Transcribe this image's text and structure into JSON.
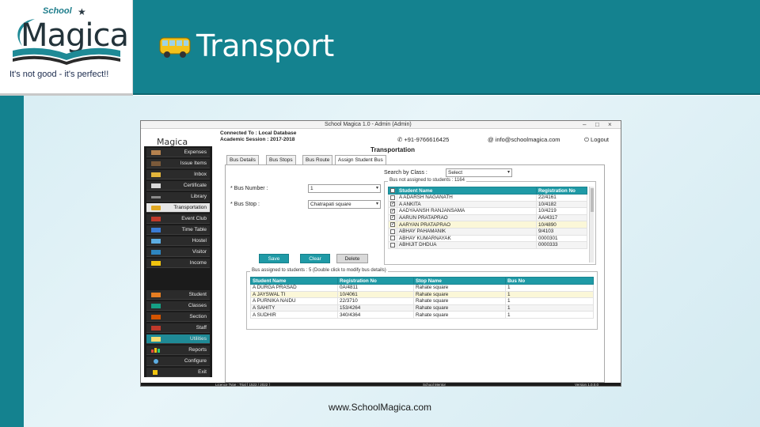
{
  "slide": {
    "title": "Transport",
    "footer_url": "www.SchoolMagica.com",
    "colors": {
      "teal": "#14828f",
      "accent": "#1f9aa6"
    }
  },
  "logo": {
    "school": "School",
    "magica": "Magica",
    "tagline": "It's not good - it's perfect!!"
  },
  "app": {
    "window_title": "School Magica 1.0   -   Admin (Admin)",
    "win_controls": [
      "–",
      "□",
      "×"
    ],
    "connection_line1": "Connected To : Local Database",
    "connection_line2": "Academic Session : 2017-2018",
    "phone": "+91-9766616425",
    "email": "info@schoolmagica.com",
    "logout": "Logout",
    "app_logo": "Magica",
    "sidebar_top": [
      {
        "label": "Expenses",
        "icon": "expenses-icon"
      },
      {
        "label": "Issue Items",
        "icon": "issue-items-icon"
      },
      {
        "label": "Inbox",
        "icon": "inbox-icon"
      },
      {
        "label": "Certificate",
        "icon": "certificate-icon"
      },
      {
        "label": "Library",
        "icon": "library-icon"
      },
      {
        "label": "Transportation",
        "icon": "bus-icon",
        "active": true
      },
      {
        "label": "Event Club",
        "icon": "event-club-icon"
      },
      {
        "label": "Time Table",
        "icon": "time-table-icon"
      },
      {
        "label": "Hostel",
        "icon": "hostel-icon"
      },
      {
        "label": "Visitor",
        "icon": "visitor-icon"
      },
      {
        "label": "Income",
        "icon": "income-icon"
      }
    ],
    "sidebar_bottom": [
      {
        "label": "Student",
        "icon": "student-icon"
      },
      {
        "label": "Classes",
        "icon": "classes-icon"
      },
      {
        "label": "Section",
        "icon": "section-icon"
      },
      {
        "label": "Staff",
        "icon": "staff-icon"
      },
      {
        "label": "Utilities",
        "icon": "utilities-icon",
        "selected": true
      },
      {
        "label": "Reports",
        "icon": "reports-icon"
      },
      {
        "label": "Configure",
        "icon": "configure-icon"
      },
      {
        "label": "Exit",
        "icon": "exit-icon"
      }
    ],
    "main_title": "Transportation",
    "tabs": [
      "Bus Details",
      "Bus Stops",
      "Bus Route",
      "Assign Student Bus"
    ],
    "form": {
      "bus_number_label": "* Bus Number :",
      "bus_number_value": "1",
      "bus_stop_label": "* Bus Stop :",
      "bus_stop_value": "Chatrapati square",
      "search_by_class_label": "Search by Class :",
      "search_by_class_value": "Select",
      "save_label": "Save",
      "clear_label": "Clear",
      "delete_label": "Delete"
    },
    "not_assigned": {
      "group_title": "Bus not assigned to students : 1164",
      "headers": [
        "Student Name",
        "Registration No"
      ],
      "rows": [
        {
          "checked": false,
          "name": "A ADARSH NAGANATH",
          "reg": "22/4161"
        },
        {
          "checked": true,
          "name": "A ANKITA",
          "reg": "10/4182"
        },
        {
          "checked": true,
          "name": "AADYAANSH RANJANSAMA",
          "reg": "10/4219"
        },
        {
          "checked": true,
          "name": "AARUN PRATAPRAO",
          "reg": "AA/4317"
        },
        {
          "checked": true,
          "name": "AARYAN PRATAPRAO",
          "reg": "10/4890"
        },
        {
          "checked": false,
          "name": "ABHAY PAHAMANIK",
          "reg": "9/4103"
        },
        {
          "checked": false,
          "name": "ABHAY KUMARNAYAK",
          "reg": "0000301"
        },
        {
          "checked": false,
          "name": "ABHIJIT DHDUA",
          "reg": "0000333"
        }
      ]
    },
    "assigned": {
      "group_title": "Bus assigned to students : 5 (Double click to modify bus details)",
      "headers": [
        "Student Name",
        "Registration No",
        "Stop Name",
        "Bus No"
      ],
      "rows": [
        {
          "name": "A DURGA PRASAD",
          "reg": "0A/4811",
          "stop": "Rahate square",
          "bus": "1"
        },
        {
          "name": "A JAYSWAL TI",
          "reg": "10/4061",
          "stop": "Rahate square",
          "bus": "1"
        },
        {
          "name": "A PURNIKA NAIDU",
          "reg": "22/3710",
          "stop": "Rahate square",
          "bus": "1"
        },
        {
          "name": "A SAHITY",
          "reg": "153/4264",
          "stop": "Rahate square",
          "bus": "1"
        },
        {
          "name": "A SUDHIR",
          "reg": "340/4364",
          "stop": "Rahate square",
          "bus": "1"
        }
      ]
    },
    "status": {
      "left": "Licence Type : Trial [ 1522 / 2022 ]",
      "middle": "School Mentor",
      "right": "Version 1.0.0.0"
    }
  }
}
